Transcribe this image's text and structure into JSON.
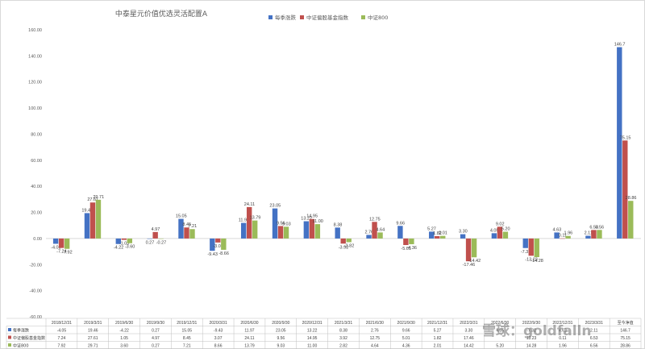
{
  "chart_data": {
    "type": "bar",
    "title": "中泰星元价值优选灵活配置A",
    "categories": [
      "2018/12/31",
      "2019/3/31",
      "2019/6/30",
      "2019/9/30",
      "2019/12/31",
      "2020/3/31",
      "2020/6/30",
      "2020/9/30",
      "2020/12/31",
      "2021/3/31",
      "2021/6/30",
      "2021/9/30",
      "2021/12/31",
      "2022/3/31",
      "2022/6/30",
      "2022/9/30",
      "2022/12/31",
      "2023/3/31",
      "至今净值"
    ],
    "ylim": [
      -60,
      160
    ],
    "yticks": [
      "-60.00",
      "-40.00",
      "-20.00",
      "0.00",
      "20.00",
      "40.00",
      "60.00",
      "80.00",
      "100.00",
      "120.00",
      "140.00",
      "160.00"
    ],
    "grid": false,
    "legend_position": "top",
    "series": [
      {
        "name": "每季涨跌",
        "color": "#4472c4",
        "values": [
          -4.05,
          19.46,
          -4.22,
          -0.27,
          15.05,
          -9.43,
          11.97,
          23.05,
          13.22,
          8.38,
          2.76,
          9.66,
          5.27,
          3.3,
          4.05,
          -7.32,
          4.63,
          2.11,
          146.7
        ],
        "labels": [
          "-4.05",
          "19.46",
          "-4.22",
          "0.27",
          "15.05",
          "-9.43",
          "11.97",
          "23.05",
          "13.22",
          "8.38",
          "2.76",
          "9.66",
          "5.27",
          "3.30",
          "4.05",
          "-7.32",
          "4.63",
          "2.11",
          "146.7"
        ],
        "table": [
          "-4.05",
          "19.46",
          "-4.22",
          "0.27",
          "15.05",
          "-9.43",
          "11.97",
          "23.05",
          "13.22",
          "8.38",
          "2.76",
          "9.66",
          "5.27",
          "3.30",
          "4.05",
          "-7.32",
          "4.63",
          "2.11",
          "146.7"
        ]
      },
      {
        "name": "中证偏股基金指数",
        "color": "#c0504d",
        "values": [
          -7.24,
          27.61,
          -1.05,
          4.97,
          8.45,
          -3.07,
          24.11,
          9.56,
          14.95,
          -3.92,
          12.75,
          -5.01,
          1.82,
          -17.46,
          9.02,
          -13.23,
          0.11,
          6.53,
          75.15
        ],
        "labels": [
          "-7.24",
          "27.61",
          "-1.05",
          "4.97",
          "8.45",
          "-3.07",
          "24.11",
          "9.56",
          "14.95",
          "-3.92",
          "12.75",
          "-5.01",
          "1.82",
          "-17.46",
          "9.02",
          "-13.23",
          "0.11",
          "6.53",
          "75.15"
        ],
        "table": [
          "7.24",
          "27.61",
          "1.05",
          "4.97",
          "8.45",
          "3.07",
          "24.11",
          "9.56",
          "14.95",
          "3.92",
          "12.75",
          "5.01",
          "1.82",
          "17.46",
          "",
          "13.23",
          "0.11",
          "6.53",
          "75.15"
        ]
      },
      {
        "name": "中证800",
        "color": "#9bbb59",
        "values": [
          -7.92,
          29.71,
          -3.6,
          -0.27,
          7.21,
          -8.66,
          13.79,
          9.03,
          11.0,
          -2.82,
          4.64,
          -4.36,
          2.01,
          -14.42,
          5.2,
          -14.28,
          1.96,
          6.56,
          28.86
        ],
        "labels": [
          "-7.92",
          "29.71",
          "-3.60",
          "-0.27",
          "7.21",
          "-8.66",
          "13.79",
          "9.03",
          "11.00",
          "-2.82",
          "4.64",
          "-4.36",
          "2.01",
          "-14.42",
          "5.20",
          "-14.28",
          "1.96",
          "6.56",
          "28.86"
        ],
        "table": [
          "7.92",
          "29.71",
          "3.60",
          "0.27",
          "7.21",
          "8.66",
          "13.79",
          "9.03",
          "11.00",
          "2.82",
          "4.64",
          "4.36",
          "2.01",
          "14.42",
          "5.20",
          "14.28",
          "1.96",
          "6.56",
          "28.86"
        ]
      }
    ]
  },
  "watermark": "雪球：goldfalln"
}
